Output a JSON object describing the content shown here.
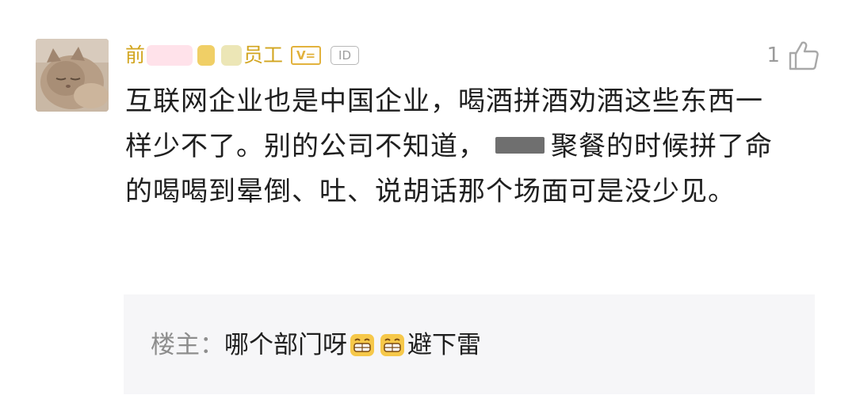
{
  "comment": {
    "author": {
      "name_start": "前",
      "name_end": "员工",
      "vip_badge": "V=",
      "id_badge": "ID"
    },
    "like": {
      "count": "1"
    },
    "body": {
      "part1": "互联网企业也是中国企业，喝酒拼酒劝酒这些东西一样少不了。别的公司不知道，",
      "part2": "聚餐的时候拼了命的喝喝到晕倒、吐、说胡话那个场面可是没少见。"
    },
    "reply": {
      "label": "楼主：",
      "text_before": "哪个部门呀",
      "text_after": "避下雷",
      "emoji": [
        "grin-emoji",
        "grin-emoji"
      ]
    }
  },
  "colors": {
    "author": "#d2a51f",
    "badge": "#e2b23d",
    "muted": "#9b9b9b",
    "reply_bg": "#f6f6f8"
  }
}
